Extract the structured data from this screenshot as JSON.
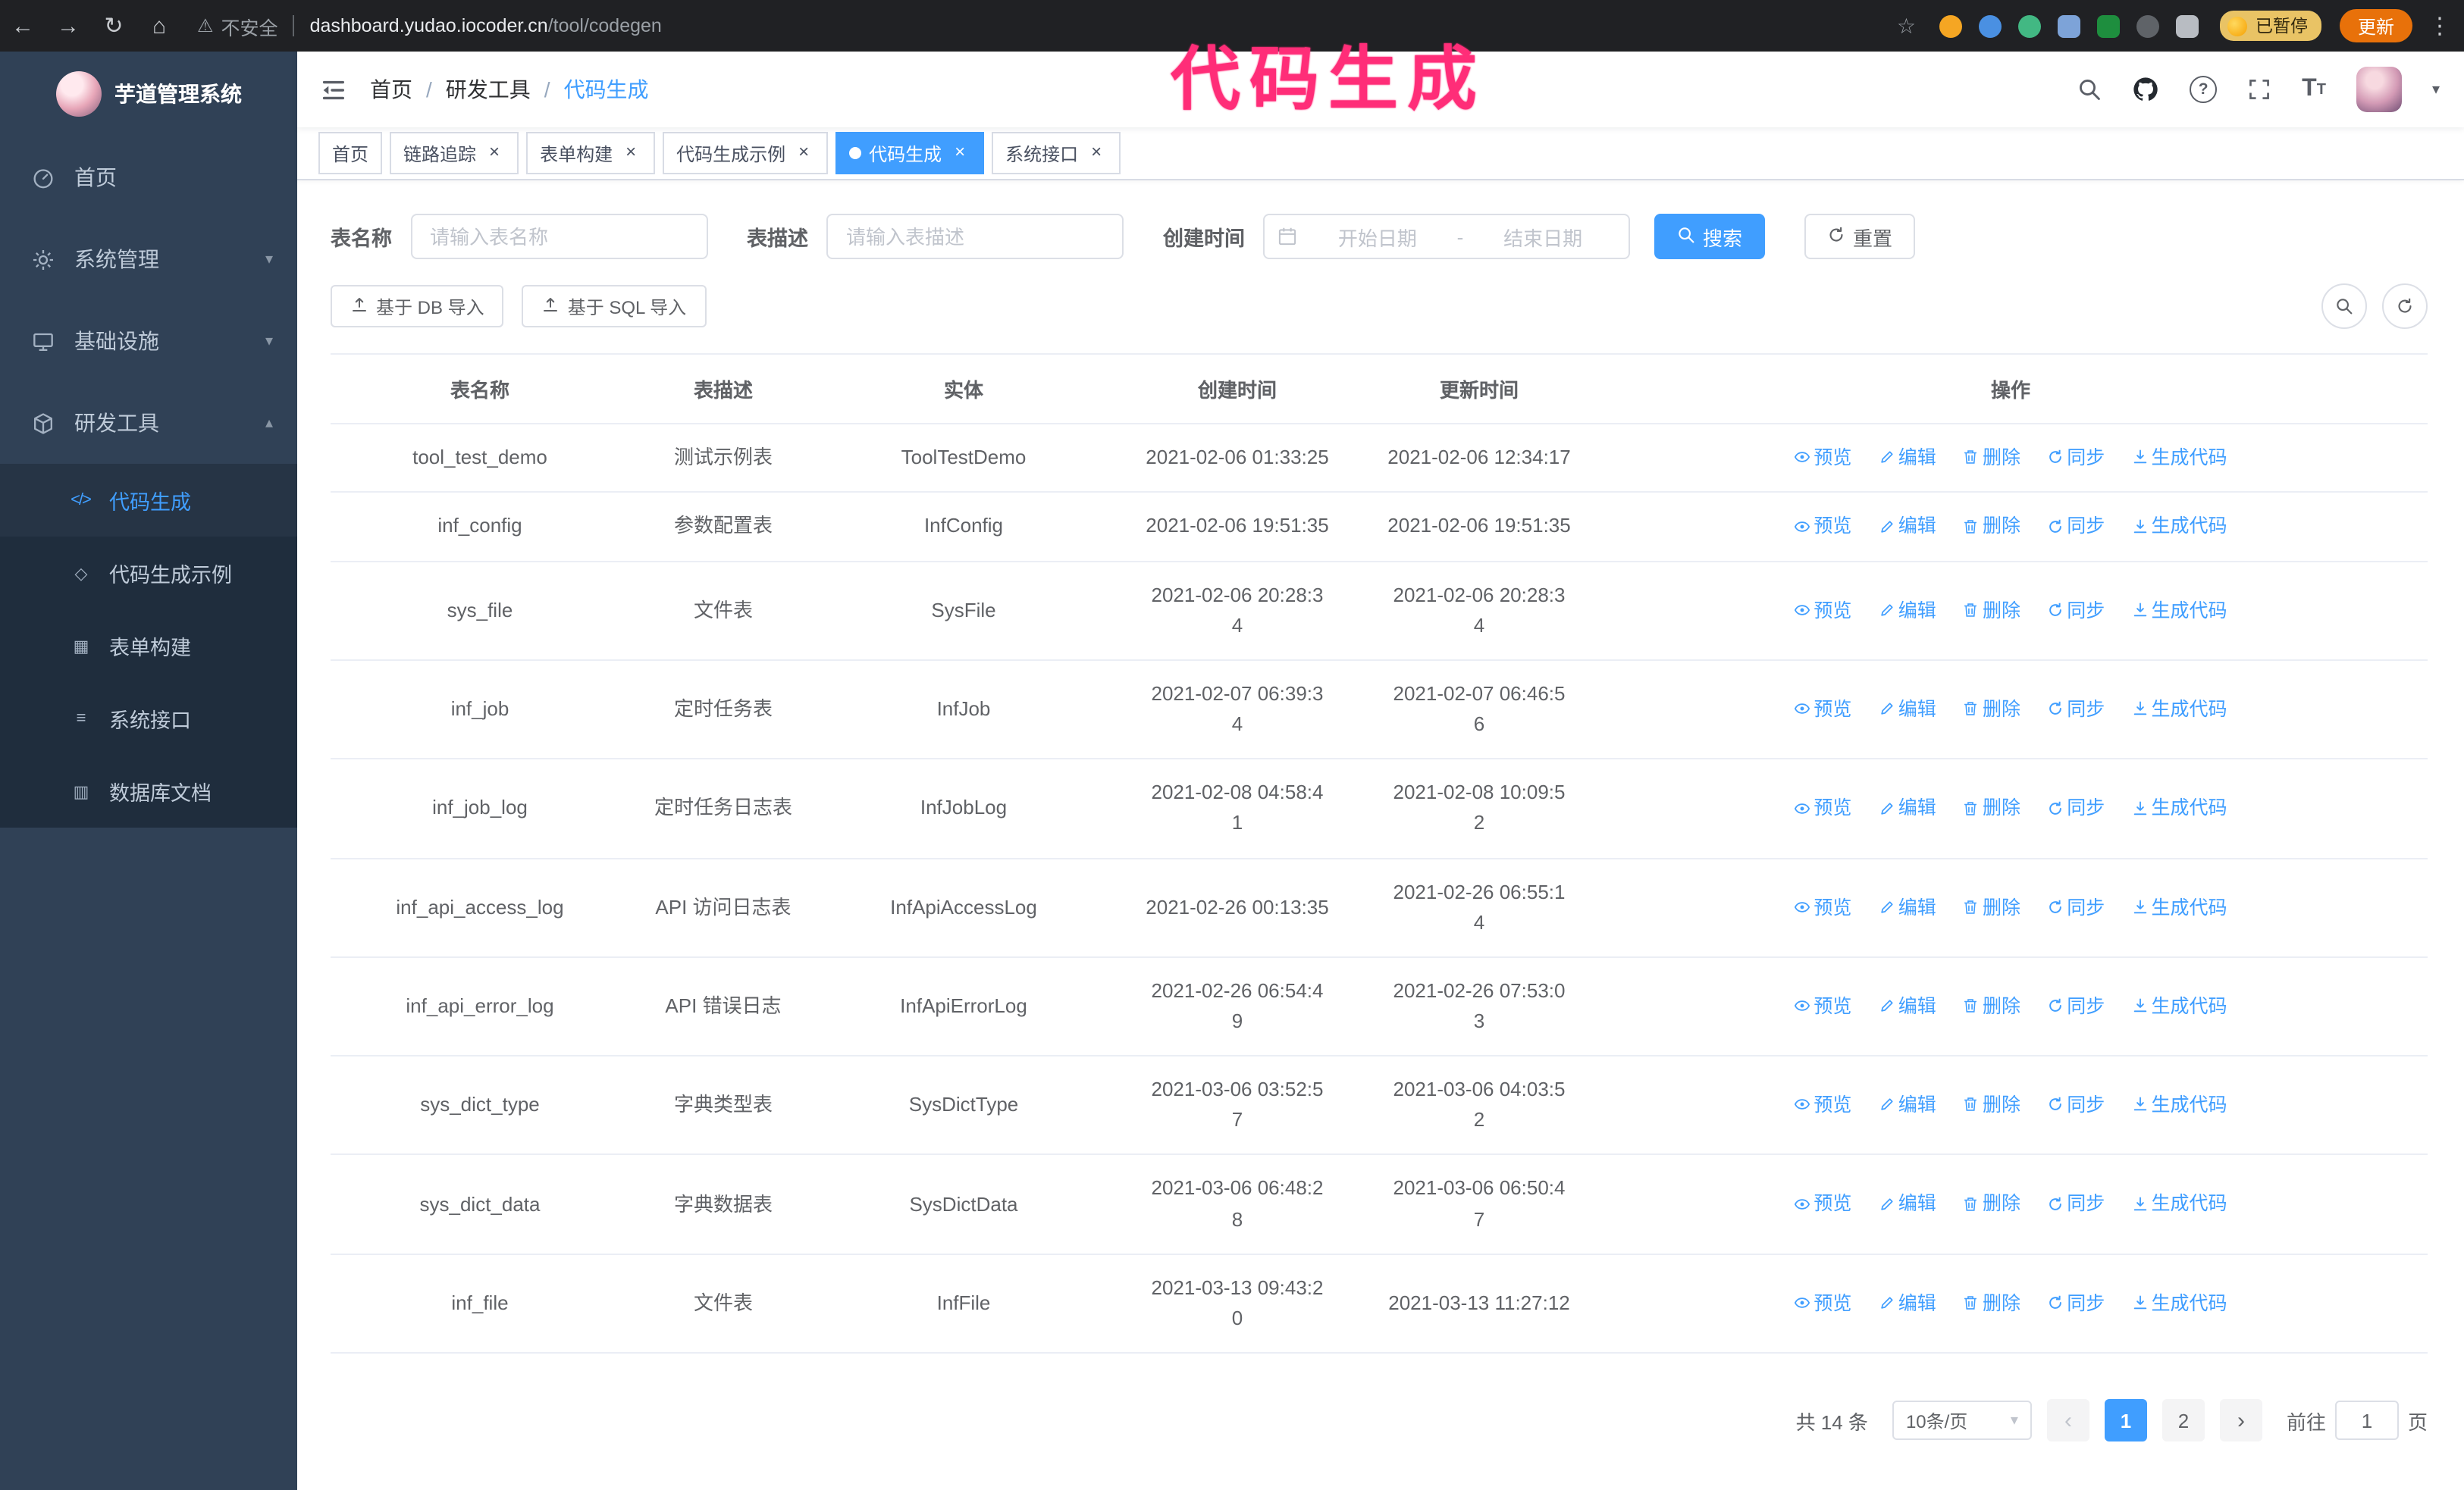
{
  "browser": {
    "security_text": "不安全",
    "url_host": "dashboard.yudao.iocoder.cn",
    "url_path": "/tool/codegen",
    "paused_label": "已暂停",
    "update_label": "更新"
  },
  "annotation": {
    "text": "代码生成"
  },
  "colors": {
    "accent": "#409eff",
    "sidebar_bg": "#304156",
    "submenu_bg": "#1f2d3d",
    "annotation_pink": "#ff2d78",
    "update_orange": "#e8710a"
  },
  "icons": {
    "back": "←",
    "forward": "→",
    "reload": "↻",
    "home": "⌂",
    "warning": "⚠",
    "star": "☆",
    "menu_dots": "⋮",
    "caret_down": "▾",
    "chevron_down": "▾",
    "chevron_up": "▴",
    "close": "×",
    "prev": "‹",
    "next": "›"
  },
  "sidebar": {
    "logo_title": "芋道管理系统",
    "items": [
      {
        "label": "首页"
      },
      {
        "label": "系统管理"
      },
      {
        "label": "基础设施"
      },
      {
        "label": "研发工具"
      }
    ],
    "submenu": [
      {
        "label": "代码生成",
        "glyph": "</>",
        "active": true
      },
      {
        "label": "代码生成示例",
        "glyph": "◇"
      },
      {
        "label": "表单构建",
        "glyph": "▦"
      },
      {
        "label": "系统接口",
        "glyph": "≡"
      },
      {
        "label": "数据库文档",
        "glyph": "▥"
      }
    ]
  },
  "header": {
    "breadcrumb": [
      "首页",
      "研发工具",
      "代码生成"
    ],
    "separator": "/"
  },
  "tabs": [
    {
      "label": "首页",
      "closable": false
    },
    {
      "label": "链路追踪",
      "closable": true
    },
    {
      "label": "表单构建",
      "closable": true
    },
    {
      "label": "代码生成示例",
      "closable": true
    },
    {
      "label": "代码生成",
      "closable": true,
      "active": true
    },
    {
      "label": "系统接口",
      "closable": true
    }
  ],
  "filters": {
    "table_name_label": "表名称",
    "table_name_placeholder": "请输入表名称",
    "table_desc_label": "表描述",
    "table_desc_placeholder": "请输入表描述",
    "create_time_label": "创建时间",
    "date_start_placeholder": "开始日期",
    "date_separator": "-",
    "date_end_placeholder": "结束日期",
    "search_label": "搜索",
    "reset_label": "重置"
  },
  "toolbar": {
    "import_db_label": "基于 DB 导入",
    "import_sql_label": "基于 SQL 导入"
  },
  "table": {
    "columns": [
      "表名称",
      "表描述",
      "实体",
      "创建时间",
      "更新时间",
      "操作"
    ],
    "actions": [
      "预览",
      "编辑",
      "删除",
      "同步",
      "生成代码"
    ],
    "rows": [
      {
        "name": "tool_test_demo",
        "desc": "测试示例表",
        "entity": "ToolTestDemo",
        "created": "2021-02-06 01:33:25",
        "created_wrap": false,
        "updated": "2021-02-06 12:34:17",
        "updated_wrap": false
      },
      {
        "name": "inf_config",
        "desc": "参数配置表",
        "entity": "InfConfig",
        "created": "2021-02-06 19:51:35",
        "created_wrap": false,
        "updated": "2021-02-06 19:51:35",
        "updated_wrap": false
      },
      {
        "name": "sys_file",
        "desc": "文件表",
        "entity": "SysFile",
        "created": "2021-02-06 20:28:34",
        "created_wrap": true,
        "updated": "2021-02-06 20:28:34",
        "updated_wrap": true
      },
      {
        "name": "inf_job",
        "desc": "定时任务表",
        "entity": "InfJob",
        "created": "2021-02-07 06:39:34",
        "created_wrap": true,
        "updated": "2021-02-07 06:46:56",
        "updated_wrap": true
      },
      {
        "name": "inf_job_log",
        "desc": "定时任务日志表",
        "entity": "InfJobLog",
        "created": "2021-02-08 04:58:41",
        "created_wrap": true,
        "updated": "2021-02-08 10:09:52",
        "updated_wrap": true
      },
      {
        "name": "inf_api_access_log",
        "desc": "API 访问日志表",
        "entity": "InfApiAccessLog",
        "created": "2021-02-26 00:13:35",
        "created_wrap": false,
        "updated": "2021-02-26 06:55:14",
        "updated_wrap": true
      },
      {
        "name": "inf_api_error_log",
        "desc": "API 错误日志",
        "entity": "InfApiErrorLog",
        "created": "2021-02-26 06:54:49",
        "created_wrap": true,
        "updated": "2021-02-26 07:53:03",
        "updated_wrap": true
      },
      {
        "name": "sys_dict_type",
        "desc": "字典类型表",
        "entity": "SysDictType",
        "created": "2021-03-06 03:52:57",
        "created_wrap": true,
        "updated": "2021-03-06 04:03:52",
        "updated_wrap": true
      },
      {
        "name": "sys_dict_data",
        "desc": "字典数据表",
        "entity": "SysDictData",
        "created": "2021-03-06 06:48:28",
        "created_wrap": true,
        "updated": "2021-03-06 06:50:47",
        "updated_wrap": true
      },
      {
        "name": "inf_file",
        "desc": "文件表",
        "entity": "InfFile",
        "created": "2021-03-13 09:43:20",
        "created_wrap": true,
        "updated": "2021-03-13 11:27:12",
        "updated_wrap": false
      }
    ]
  },
  "pagination": {
    "total_label": "共 14 条",
    "page_size_label": "10条/页",
    "pages": [
      {
        "label": "1",
        "active": true
      },
      {
        "label": "2",
        "active": false
      }
    ],
    "goto_label": "前往",
    "goto_value": "1",
    "goto_unit": "页"
  }
}
